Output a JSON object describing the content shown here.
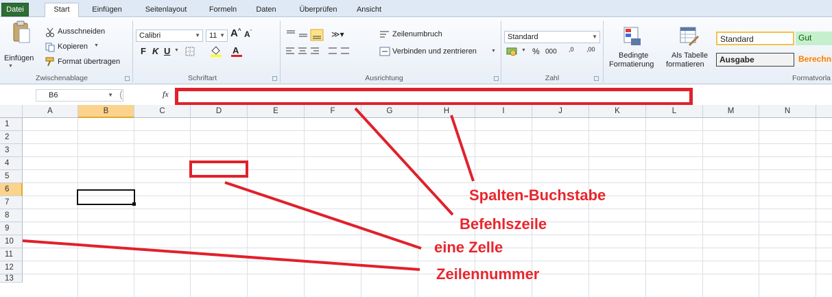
{
  "tabs": [
    "Datei",
    "Start",
    "Einfügen",
    "Seitenlayout",
    "Formeln",
    "Daten",
    "Überprüfen",
    "Ansicht"
  ],
  "clipboard": {
    "paste": "Einfügen",
    "cut": "Ausschneiden",
    "copy": "Kopieren",
    "format_painter": "Format übertragen",
    "label": "Zwischenablage"
  },
  "font": {
    "family": "Calibri",
    "size": "11",
    "bold": "F",
    "italic": "K",
    "underline": "U",
    "label": "Schriftart"
  },
  "alignment": {
    "wrap": "Zeilenumbruch",
    "merge": "Verbinden und zentrieren",
    "label": "Ausrichtung"
  },
  "number": {
    "format": "Standard",
    "percent": "%",
    "thousands": "000",
    "inc_dec": ",0",
    "inc_dec2": ",00",
    "label": "Zahl"
  },
  "styles": {
    "conditional_1": "Bedingte",
    "conditional_2": "Formatierung",
    "table_1": "Als Tabelle",
    "table_2": "formatieren",
    "cell_standard": "Standard",
    "cell_gut": "Gut",
    "cell_ausgabe": "Ausgabe",
    "cell_berechnung": "Berechn",
    "label": "Formatvorla"
  },
  "formula_bar": {
    "name_box": "B6",
    "fx": "fx",
    "value": ""
  },
  "columns": [
    "A",
    "B",
    "C",
    "D",
    "E",
    "F",
    "G",
    "H",
    "I",
    "J",
    "K",
    "L",
    "M",
    "N"
  ],
  "rows": [
    "1",
    "2",
    "3",
    "4",
    "5",
    "6",
    "7",
    "8",
    "9",
    "10",
    "11",
    "12",
    "13"
  ],
  "annotations": {
    "column_letter": "Spalten-Buchstabe",
    "command_line": "Befehlszeile",
    "a_cell": "eine Zelle",
    "row_number": "Zeilennummer"
  },
  "colors": {
    "annotation": "#e8262d",
    "file_tab": "#2d6e35",
    "selection": "#000000",
    "good_fill": "#c6efce",
    "good_text": "#006100",
    "calc_text": "#fa7d00"
  }
}
